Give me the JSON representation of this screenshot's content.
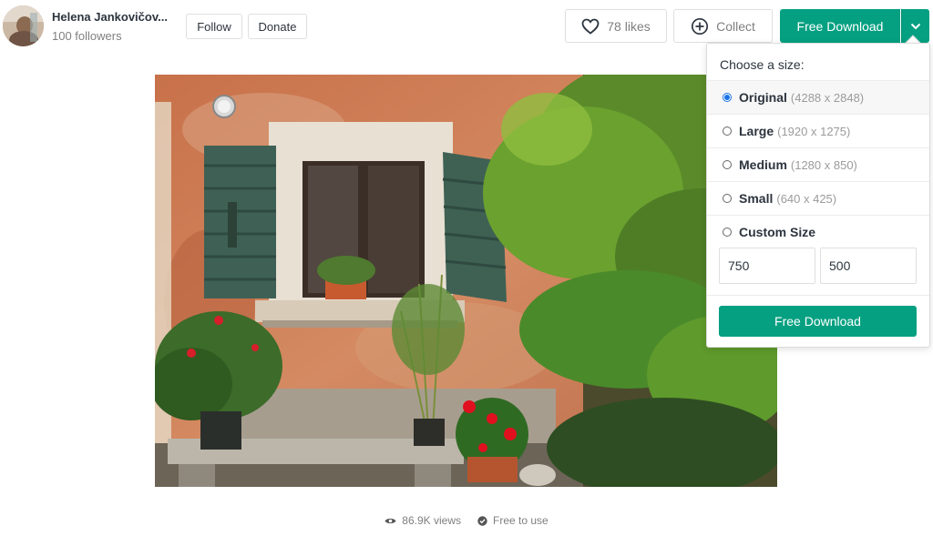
{
  "author": {
    "name": "Helena Jankovičov...",
    "followers": "100 followers"
  },
  "buttons": {
    "follow": "Follow",
    "donate": "Donate",
    "likes": "78 likes",
    "collect": "Collect",
    "free_download": "Free Download"
  },
  "size_menu": {
    "heading": "Choose a size:",
    "options": [
      {
        "label": "Original",
        "dims": "(4288 x 2848)",
        "selected": true
      },
      {
        "label": "Large",
        "dims": "(1920 x 1275)",
        "selected": false
      },
      {
        "label": "Medium",
        "dims": "(1280 x 850)",
        "selected": false
      },
      {
        "label": "Small",
        "dims": "(640 x 425)",
        "selected": false
      },
      {
        "label": "Custom Size",
        "dims": "",
        "selected": false
      }
    ],
    "custom_width": "750",
    "custom_height": "500",
    "download_label": "Free Download"
  },
  "stats": {
    "views": "86.9K views",
    "license": "Free to use"
  },
  "icons": {
    "likes": "heart-icon",
    "collect": "plus-circle-icon",
    "caret": "chevron-down-icon",
    "views": "eye-icon",
    "license": "check-circle-icon"
  },
  "colors": {
    "accent": "#05a081",
    "radio_selected": "#1a73e8"
  }
}
